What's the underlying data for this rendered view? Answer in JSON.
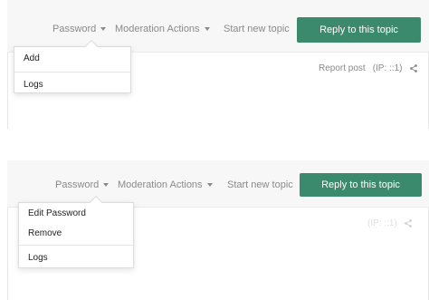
{
  "top": {
    "nav": {
      "password": "Password",
      "moderation": "Moderation Actions",
      "start_topic": "Start new topic",
      "reply": "Reply to this topic"
    },
    "dropdown": {
      "items": [
        "Add",
        "Logs"
      ]
    },
    "post": {
      "report": "Report post",
      "ip": "(IP: ::1)"
    }
  },
  "bottom": {
    "nav": {
      "password": "Password",
      "moderation": "Moderation Actions",
      "start_topic": "Start new topic",
      "reply": "Reply to this topic"
    },
    "dropdown": {
      "items": [
        "Edit Password",
        "Remove",
        "Logs"
      ]
    },
    "post": {
      "ip": "(IP: ::1)"
    }
  },
  "colors": {
    "accent": "#3b8a6e",
    "muted_text": "#8a8a8a",
    "header_bg": "#f7f7f7"
  },
  "icons": [
    "caret-down-icon",
    "share-icon"
  ]
}
